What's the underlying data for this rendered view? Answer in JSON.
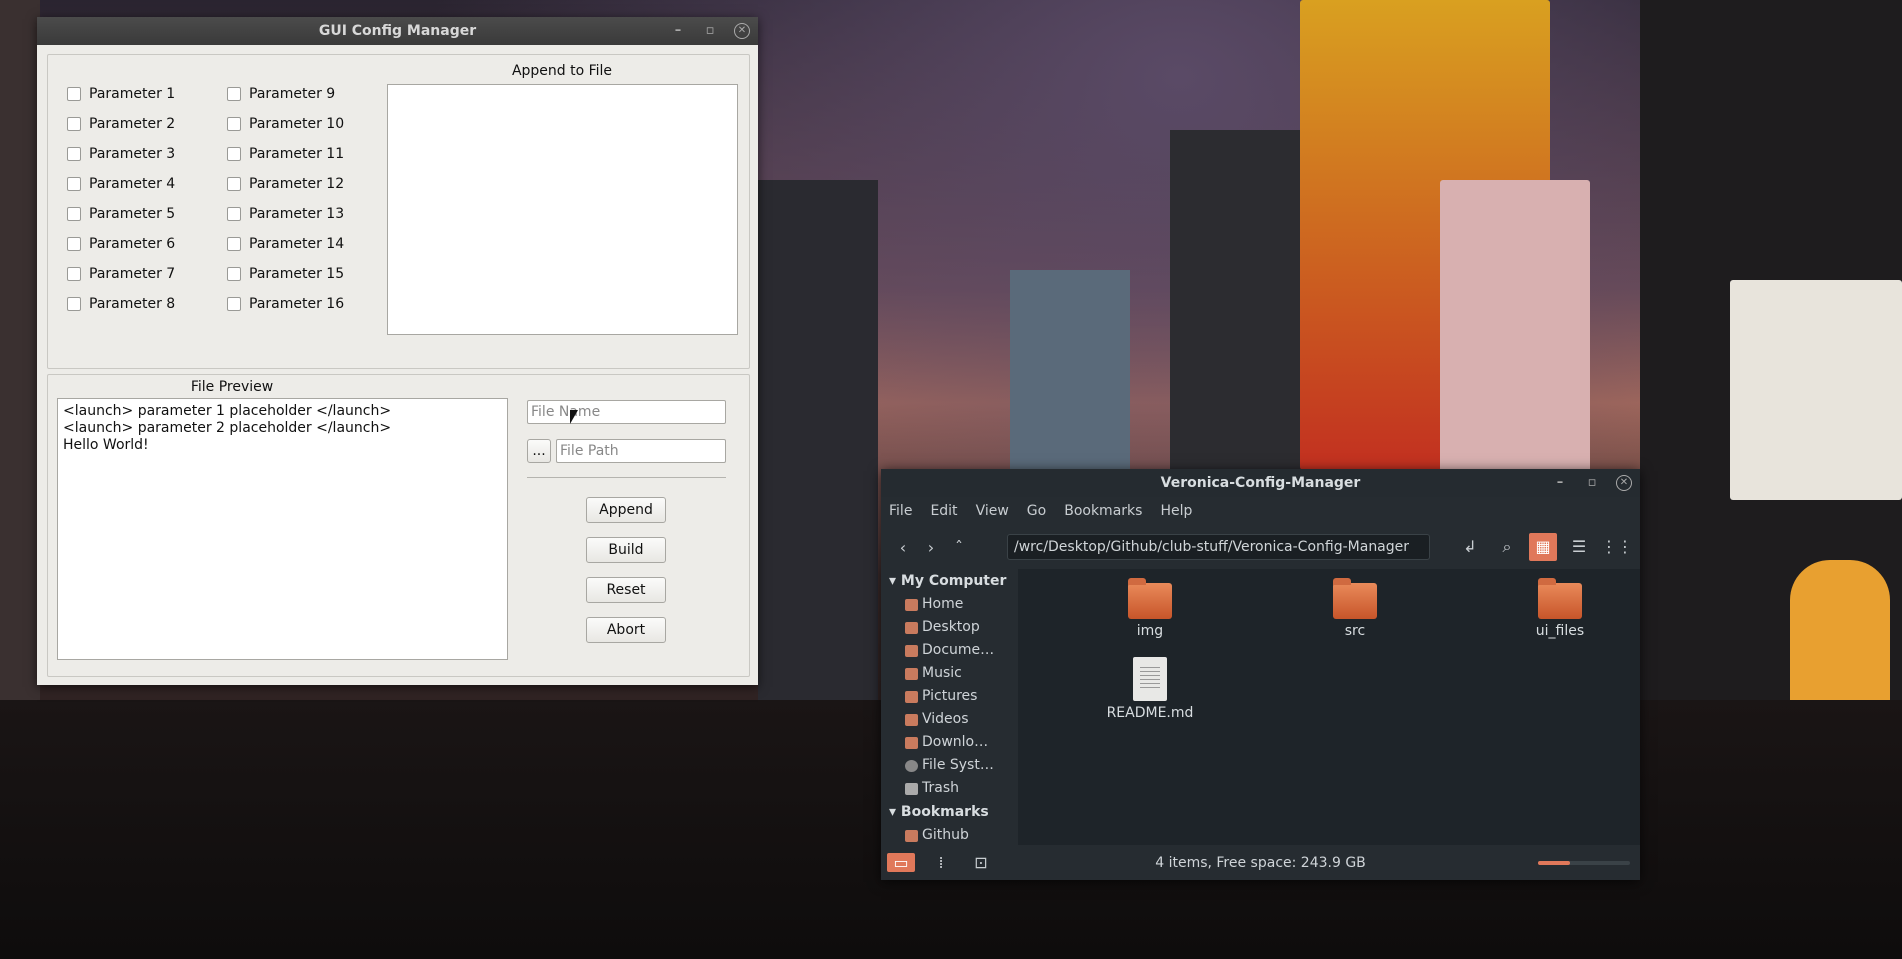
{
  "gui_window": {
    "title": "GUI Config Manager",
    "params_col1": [
      "Parameter 1",
      "Parameter 2",
      "Parameter 3",
      "Parameter 4",
      "Parameter 5",
      "Parameter 6",
      "Parameter 7",
      "Parameter 8"
    ],
    "params_col2": [
      "Parameter 9",
      "Parameter 10",
      "Parameter 11",
      "Parameter 12",
      "Parameter 13",
      "Parameter 14",
      "Parameter 15",
      "Parameter 16"
    ],
    "append_title": "Append to File",
    "preview_title": "File Preview",
    "preview_lines": [
      "<launch> parameter 1 placeholder </launch>",
      "<launch> parameter 2 placeholder </launch>",
      "Hello World!"
    ],
    "file_name_placeholder": "File Name",
    "file_path_placeholder": "File Path",
    "browse_label": "...",
    "buttons": {
      "append": "Append",
      "build": "Build",
      "reset": "Reset",
      "abort": "Abort"
    }
  },
  "file_manager": {
    "title": "Veronica-Config-Manager",
    "menu": [
      "File",
      "Edit",
      "View",
      "Go",
      "Bookmarks",
      "Help"
    ],
    "path": "/wrc/Desktop/Github/club-stuff/Veronica-Config-Manager",
    "sidebar": {
      "section1": "My Computer",
      "items": [
        {
          "label": "Home",
          "icon": "home-icon"
        },
        {
          "label": "Desktop",
          "icon": "desktop-icon"
        },
        {
          "label": "Docume…",
          "icon": "documents-icon"
        },
        {
          "label": "Music",
          "icon": "music-icon"
        },
        {
          "label": "Pictures",
          "icon": "pictures-icon"
        },
        {
          "label": "Videos",
          "icon": "videos-icon"
        },
        {
          "label": "Downlo…",
          "icon": "downloads-icon"
        },
        {
          "label": "File Syst…",
          "icon": "filesystem-icon"
        },
        {
          "label": "Trash",
          "icon": "trash-icon"
        }
      ],
      "section2": "Bookmarks",
      "partial_item": "Github"
    },
    "files": [
      {
        "name": "img",
        "type": "folder"
      },
      {
        "name": "src",
        "type": "folder"
      },
      {
        "name": "ui_files",
        "type": "folder"
      },
      {
        "name": "README.md",
        "type": "document"
      }
    ],
    "status": "4 items, Free space: 243.9 GB",
    "zoom_level": 0.35
  }
}
